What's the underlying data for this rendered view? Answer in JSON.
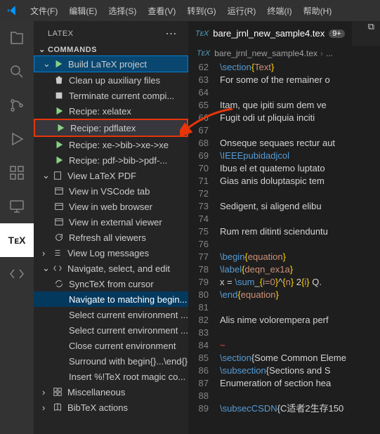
{
  "menubar": {
    "items": [
      "文件(F)",
      "编辑(E)",
      "选择(S)",
      "查看(V)",
      "转到(G)",
      "运行(R)",
      "终端(I)",
      "帮助(H)"
    ]
  },
  "sidebar": {
    "title": "LATEX",
    "section": "COMMANDS",
    "commands": [
      {
        "label": "Build LaTeX project",
        "icon": "play",
        "chevron": true,
        "depth": 1,
        "selected": true
      },
      {
        "label": "Clean up auxiliary files",
        "icon": "trash",
        "depth": 2
      },
      {
        "label": "Terminate current compi...",
        "icon": "stop",
        "depth": 2
      },
      {
        "label": "Recipe: xelatex",
        "icon": "play",
        "depth": 2
      },
      {
        "label": "Recipe: pdflatex",
        "icon": "play",
        "depth": 2,
        "red": true
      },
      {
        "label": "Recipe: xe->bib->xe->xe",
        "icon": "play",
        "depth": 2
      },
      {
        "label": "Recipe: pdf->bib->pdf-...",
        "icon": "play",
        "depth": 2
      },
      {
        "label": "View LaTeX PDF",
        "icon": "pdf",
        "chevron": true,
        "depth": 1
      },
      {
        "label": "View in VSCode tab",
        "icon": "window",
        "depth": 2
      },
      {
        "label": "View in web browser",
        "icon": "window",
        "depth": 2
      },
      {
        "label": "View in external viewer",
        "icon": "window",
        "depth": 2
      },
      {
        "label": "Refresh all viewers",
        "icon": "refresh",
        "depth": 2
      },
      {
        "label": "View Log messages",
        "icon": "list",
        "chevron": false,
        "chevRight": true,
        "depth": 1
      },
      {
        "label": "Navigate, select, and edit",
        "icon": "code",
        "chevron": true,
        "depth": 1
      },
      {
        "label": "SyncTeX from cursor",
        "icon": "sync",
        "depth": 2
      },
      {
        "label": "Navigate to matching begin...",
        "icon": "",
        "depth": 2,
        "highlight": true
      },
      {
        "label": "Select current environment ...",
        "icon": "",
        "depth": 2
      },
      {
        "label": "Select current environment ...",
        "icon": "",
        "depth": 2
      },
      {
        "label": "Close current environment",
        "icon": "",
        "depth": 2
      },
      {
        "label": "Surround with begin{}...\\end{}",
        "icon": "",
        "depth": 2
      },
      {
        "label": "Insert %!TeX root magic co...",
        "icon": "",
        "depth": 2
      },
      {
        "label": "Miscellaneous",
        "icon": "misc",
        "chevRight": true,
        "depth": 1
      },
      {
        "label": "BibTeX actions",
        "icon": "book",
        "chevRight": true,
        "depth": 1
      }
    ]
  },
  "editor": {
    "tab_label": "bare_jrnl_new_sample4.tex",
    "tab_badge": "9+",
    "breadcrumb": "bare_jrnl_new_sample4.tex",
    "lines": [
      {
        "n": 62,
        "text": "\\section{Text}"
      },
      {
        "n": 63,
        "text": "For some of the remainer o"
      },
      {
        "n": 64,
        "text": ""
      },
      {
        "n": 65,
        "text": "Itam, que ipiti sum dem ve"
      },
      {
        "n": 66,
        "text": "Fugit odi ut pliquia inciti"
      },
      {
        "n": 67,
        "text": ""
      },
      {
        "n": 68,
        "text": "Onseque sequaes rectur aut"
      },
      {
        "n": 69,
        "text": "\\IEEEpubidadjcol"
      },
      {
        "n": 70,
        "text": "Ibus el et quatemo luptato"
      },
      {
        "n": 71,
        "text": "Gias anis doluptaspic tem "
      },
      {
        "n": 72,
        "text": ""
      },
      {
        "n": 73,
        "text": "Sedigent, si aligend elibu"
      },
      {
        "n": 74,
        "text": ""
      },
      {
        "n": 75,
        "text": "Rum rem ditinti scienduntu"
      },
      {
        "n": 76,
        "text": ""
      },
      {
        "n": 77,
        "text": "\\begin{equation}"
      },
      {
        "n": 78,
        "text": "\\label{deqn_ex1a}"
      },
      {
        "n": 79,
        "text": "x = \\sum_{i=0}^{n} 2{i} Q."
      },
      {
        "n": 80,
        "text": "\\end{equation}"
      },
      {
        "n": 81,
        "text": ""
      },
      {
        "n": 82,
        "text": "Alis nime volorempera perf"
      },
      {
        "n": 83,
        "text": ""
      },
      {
        "n": 84,
        "text": "~"
      },
      {
        "n": 85,
        "text": "\\section{Some Common Eleme"
      },
      {
        "n": 86,
        "text": "\\subsection{Sections and S"
      },
      {
        "n": 87,
        "text": "Enumeration of section hea"
      },
      {
        "n": 88,
        "text": ""
      },
      {
        "n": 89,
        "text": "\\subsecCSDN{C适者2生存150"
      }
    ]
  }
}
